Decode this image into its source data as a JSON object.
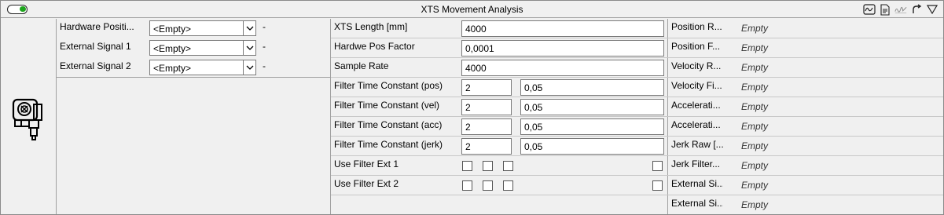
{
  "header": {
    "title": "XTS Movement Analysis",
    "toggle_on": true,
    "accent": "#1ea51e",
    "icons": [
      "chart-icon",
      "document-icon",
      "signature-icon",
      "redo-icon",
      "filter-icon"
    ]
  },
  "signals": [
    {
      "label": "Hardware Positi...",
      "value": "<Empty>",
      "dash": "-"
    },
    {
      "label": "External Signal 1",
      "value": "<Empty>",
      "dash": "-"
    },
    {
      "label": "External Signal 2",
      "value": "<Empty>",
      "dash": "-"
    }
  ],
  "params": {
    "xts_length": {
      "label": "XTS Length [mm]",
      "value": "4000"
    },
    "hw_pos_factor": {
      "label": "Hardwe Pos Factor",
      "value": "0,0001"
    },
    "sample_rate": {
      "label": "Sample Rate",
      "value": "4000"
    },
    "filters": [
      {
        "label": "Filter Time Constant (pos)",
        "a": "2",
        "b": "0,05"
      },
      {
        "label": "Filter Time Constant (vel)",
        "a": "2",
        "b": "0,05"
      },
      {
        "label": "Filter Time Constant (acc)",
        "a": "2",
        "b": "0,05"
      },
      {
        "label": "Filter Time Constant (jerk)",
        "a": "2",
        "b": "0,05"
      }
    ],
    "use_filter": [
      {
        "label": "Use Filter Ext 1",
        "checks": [
          false,
          false,
          false,
          false
        ]
      },
      {
        "label": "Use Filter Ext 2",
        "checks": [
          false,
          false,
          false,
          false
        ]
      }
    ]
  },
  "outputs": [
    {
      "label": "Position R...",
      "value": "Empty"
    },
    {
      "label": "Position F...",
      "value": "Empty"
    },
    {
      "label": "Velocity R...",
      "value": "Empty"
    },
    {
      "label": "Velocity Fi...",
      "value": "Empty"
    },
    {
      "label": "Accelerati...",
      "value": "Empty"
    },
    {
      "label": "Accelerati...",
      "value": "Empty"
    },
    {
      "label": "Jerk Raw [...",
      "value": "Empty"
    },
    {
      "label": "Jerk Filter...",
      "value": "Empty"
    },
    {
      "label": "External Si...",
      "value": "Empty"
    },
    {
      "label": "External Si...",
      "value": "Empty"
    }
  ]
}
